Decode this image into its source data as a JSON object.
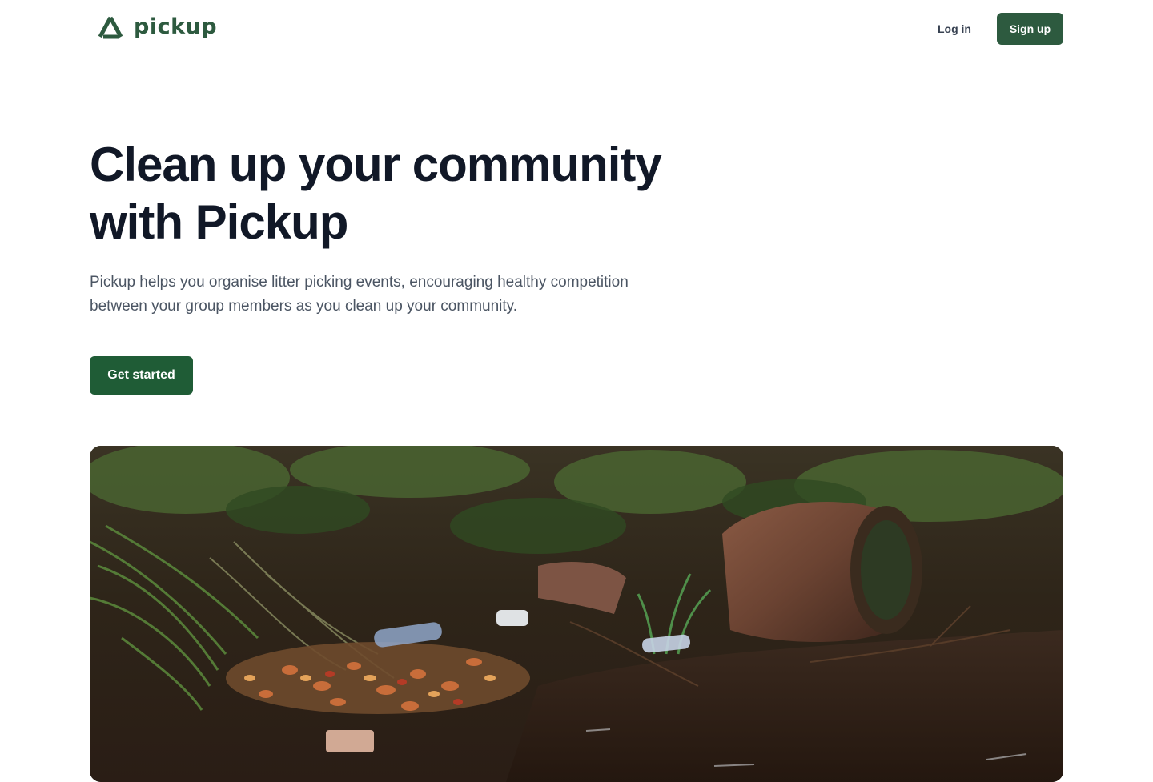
{
  "brand": {
    "name": "pickup",
    "logo_icon": "recycle-triangle-icon",
    "color": "#2d5a3f"
  },
  "nav": {
    "login_label": "Log in",
    "signup_label": "Sign up"
  },
  "hero": {
    "title_line1": "Clean up your community",
    "title_line2": "with Pickup",
    "description_line1": "Pickup helps you organise litter picking events, encouraging healthy competition",
    "description_line2": "between your group members as you clean up your community.",
    "cta_label": "Get started",
    "cta_color": "#1f5c36"
  },
  "image": {
    "subject": "litter-in-stream-photo"
  }
}
